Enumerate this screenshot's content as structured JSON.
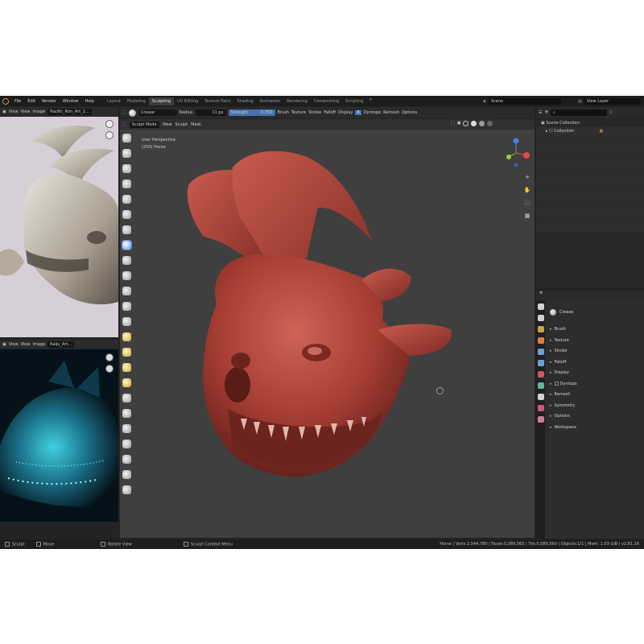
{
  "menu": {
    "items": [
      "File",
      "Edit",
      "Render",
      "Window",
      "Help"
    ]
  },
  "workspaces": {
    "tabs": [
      "Layout",
      "Modeling",
      "Sculpting",
      "UV Editing",
      "Texture Paint",
      "Shading",
      "Animation",
      "Rendering",
      "Compositing",
      "Scripting"
    ],
    "active_index": 2,
    "add_label": "+"
  },
  "scene": {
    "value": "Scene"
  },
  "view_layer": {
    "value": "View Layer"
  },
  "ref_top_header": {
    "view": "View",
    "view2": "View",
    "image": "Image",
    "file": "Pacific_Rim_Art_1..."
  },
  "ref_bot_header": {
    "view": "View",
    "view2": "View",
    "image": "Image",
    "file": "Kaiju_Art..."
  },
  "tool_header": {
    "brush": "Crease",
    "radius_label": "Radius",
    "radius_value": "11 px",
    "strength_label": "Strength",
    "strength_value": "0.350",
    "menus": [
      "Brush",
      "Texture",
      "Stroke",
      "Falloff",
      "Display"
    ],
    "dyntopo": "Dyntopo",
    "remesh": "Remesh",
    "options": "Options"
  },
  "viewport_header": {
    "mode": "Sculpt Mode",
    "menus": [
      "View",
      "Sculpt",
      "Mask"
    ]
  },
  "viewport": {
    "perspective": "User Perspective",
    "object": "(250) Horse",
    "model_color": "#b2453b"
  },
  "nav_buttons": [
    "+",
    "✋",
    "🎥",
    "▦"
  ],
  "outliner": {
    "root": "Scene Collection",
    "collection": "Collection"
  },
  "properties": {
    "brush_name": "Crease",
    "sections": [
      "Brush",
      "Texture",
      "Stroke",
      "Falloff",
      "Display",
      "Dyntopo",
      "Remesh",
      "Symmetry",
      "Options",
      "Workspace"
    ],
    "tab_colors": [
      "#d0d0d0",
      "#d0d0d0",
      "#c9a24a",
      "#e07b3c",
      "#6aa0d8",
      "#6aa0d8",
      "#c95a5a",
      "#5ab8a0",
      "#d0d0d0",
      "#c95a7a",
      "#d27a9a"
    ]
  },
  "statusbar": {
    "left": [
      "Sculpt",
      "Move",
      "Rotate View",
      "Sculpt Context Menu"
    ],
    "right": "Horse | Verts:2,544,780 | Faces:5,089,560 | Tris:5,089,560 | Objects:1/1 | Mem: 1.03 GiB | v2.81.16"
  }
}
